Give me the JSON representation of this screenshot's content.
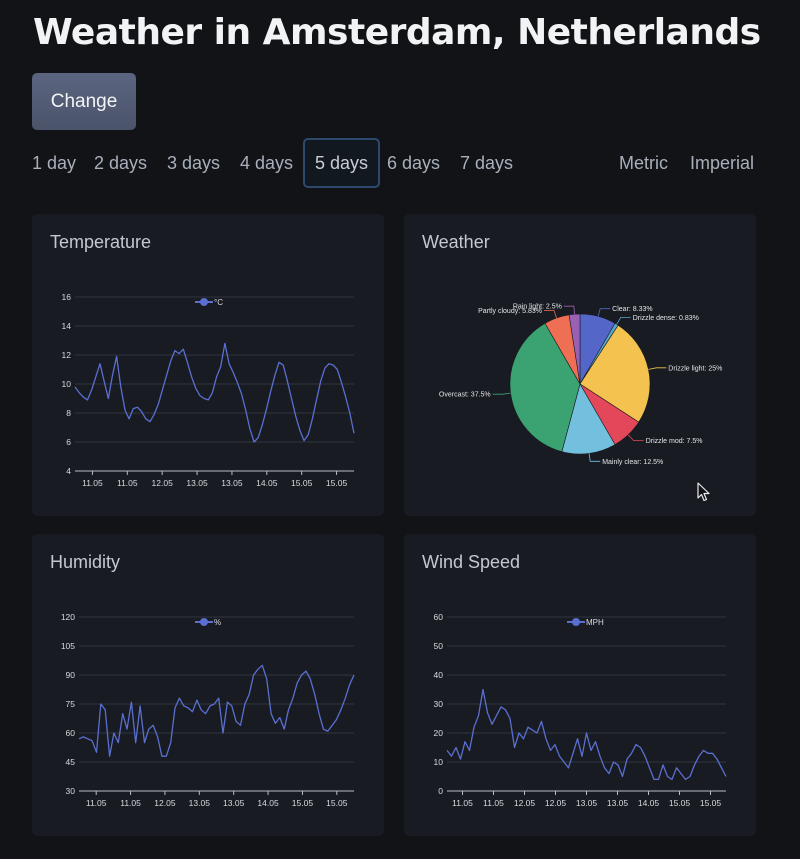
{
  "page": {
    "title": "Weather in Amsterdam, Netherlands"
  },
  "toolbar": {
    "change_label": "Change"
  },
  "day_tabs": [
    {
      "label": "1 day"
    },
    {
      "label": "2 days"
    },
    {
      "label": "3 days"
    },
    {
      "label": "4 days"
    },
    {
      "label": "5 days",
      "active": true
    },
    {
      "label": "6 days"
    },
    {
      "label": "7 days"
    }
  ],
  "unit_tabs": [
    {
      "label": "Metric"
    },
    {
      "label": "Imperial"
    }
  ],
  "colors": {
    "line": "#5a6fd0",
    "background": "#111317",
    "card": "#181b22",
    "active_tab_border": "#2c4a6c",
    "button": "#535c75"
  },
  "cursor": {
    "icon": "mouse-pointer-icon"
  },
  "cards": {
    "temperature": {
      "title": "Temperature"
    },
    "weather": {
      "title": "Weather"
    },
    "humidity": {
      "title": "Humidity"
    },
    "wind": {
      "title": "Wind Speed"
    }
  },
  "chart_data": [
    {
      "id": "temperature",
      "type": "line",
      "title": "Temperature",
      "series": [
        {
          "name": "°C",
          "values": [
            9.8,
            9.4,
            9.1,
            8.9,
            9.6,
            10.5,
            11.4,
            10.2,
            9.0,
            10.6,
            11.9,
            9.8,
            8.2,
            7.6,
            8.3,
            8.4,
            8.1,
            7.6,
            7.4,
            7.9,
            8.6,
            9.6,
            10.6,
            11.6,
            12.3,
            12.1,
            12.4,
            11.5,
            10.5,
            9.7,
            9.2,
            9.0,
            8.9,
            9.4,
            10.5,
            11.2,
            12.8,
            11.4,
            10.8,
            10.1,
            9.3,
            8.2,
            6.9,
            6.0,
            6.3,
            7.2,
            8.3,
            9.5,
            10.6,
            11.5,
            11.3,
            10.2,
            9.0,
            7.8,
            6.8,
            6.1,
            6.5,
            7.6,
            8.9,
            10.2,
            11.1,
            11.4,
            11.3,
            11.0,
            10.1,
            9.1,
            8.0,
            6.6
          ]
        }
      ],
      "x_tick_labels": [
        "11.05",
        "11.05",
        "12.05",
        "13.05",
        "13.05",
        "14.05",
        "15.05",
        "15.05"
      ],
      "ylim": [
        4,
        16
      ],
      "y_ticks": [
        4,
        6,
        8,
        10,
        12,
        14,
        16
      ],
      "grid": "horizontal",
      "legend": "top-center"
    },
    {
      "id": "weather",
      "type": "pie",
      "title": "Weather",
      "slices": [
        {
          "label": "Clear",
          "value": 8.33,
          "text": "Clear: 8.33%",
          "color": "#5467c9"
        },
        {
          "label": "Drizzle dense",
          "value": 0.83,
          "text": "Drizzle dense: 0.83%",
          "color": "#5aa7c9"
        },
        {
          "label": "Drizzle light",
          "value": 25,
          "text": "Drizzle light: 25%",
          "color": "#f4c24e"
        },
        {
          "label": "Drizzle mod",
          "value": 7.5,
          "text": "Drizzle mod: 7.5%",
          "color": "#e3485a"
        },
        {
          "label": "Mainly clear",
          "value": 12.5,
          "text": "Mainly clear: 12.5%",
          "color": "#73c0de"
        },
        {
          "label": "Overcast",
          "value": 37.5,
          "text": "Overcast: 37.5%",
          "color": "#3ba272"
        },
        {
          "label": "Partly cloudy",
          "value": 5.83,
          "text": "Partly cloudy: 5.83%",
          "color": "#ee6f53"
        },
        {
          "label": "Rain light",
          "value": 2.5,
          "text": "Rain light: 2.5%",
          "color": "#9a60b4"
        }
      ]
    },
    {
      "id": "humidity",
      "type": "line",
      "title": "Humidity",
      "series": [
        {
          "name": "%",
          "values": [
            57,
            58,
            57,
            56,
            50,
            75,
            72,
            48,
            60,
            55,
            70,
            62,
            76,
            55,
            74,
            55,
            62,
            64,
            58,
            48,
            48,
            55,
            73,
            78,
            74,
            73,
            71,
            77,
            72,
            70,
            74,
            75,
            78,
            60,
            76,
            74,
            66,
            64,
            75,
            80,
            90,
            93,
            95,
            88,
            70,
            65,
            68,
            62,
            72,
            78,
            86,
            90,
            92,
            88,
            80,
            70,
            62,
            61,
            64,
            67,
            72,
            78,
            85,
            90
          ]
        }
      ],
      "x_tick_labels": [
        "11.05",
        "11.05",
        "12.05",
        "13.05",
        "13.05",
        "14.05",
        "15.05",
        "15.05"
      ],
      "ylim": [
        30,
        120
      ],
      "y_ticks": [
        30,
        45,
        60,
        75,
        90,
        105,
        120
      ],
      "grid": "horizontal",
      "legend": "top-center"
    },
    {
      "id": "wind",
      "type": "line",
      "title": "Wind Speed",
      "series": [
        {
          "name": "MPH",
          "values": [
            14,
            12,
            15,
            11,
            17,
            14,
            22,
            26,
            35,
            27,
            23,
            26,
            29,
            28,
            25,
            15,
            20,
            18,
            22,
            21,
            20,
            24,
            18,
            14,
            16,
            12,
            10,
            8,
            13,
            18,
            12,
            20,
            14,
            17,
            12,
            8,
            6,
            10,
            9,
            5,
            11,
            13,
            16,
            15,
            12,
            8,
            4,
            4,
            9,
            5,
            4,
            8,
            6,
            4,
            5,
            9,
            12,
            14,
            13,
            13,
            11,
            8,
            5
          ]
        }
      ],
      "x_tick_labels": [
        "11.05",
        "11.05",
        "12.05",
        "12.05",
        "13.05",
        "13.05",
        "14.05",
        "15.05",
        "15.05"
      ],
      "ylim": [
        0,
        60
      ],
      "y_ticks": [
        0,
        10,
        20,
        30,
        40,
        50,
        60
      ],
      "grid": "horizontal",
      "legend": "top-center"
    }
  ]
}
